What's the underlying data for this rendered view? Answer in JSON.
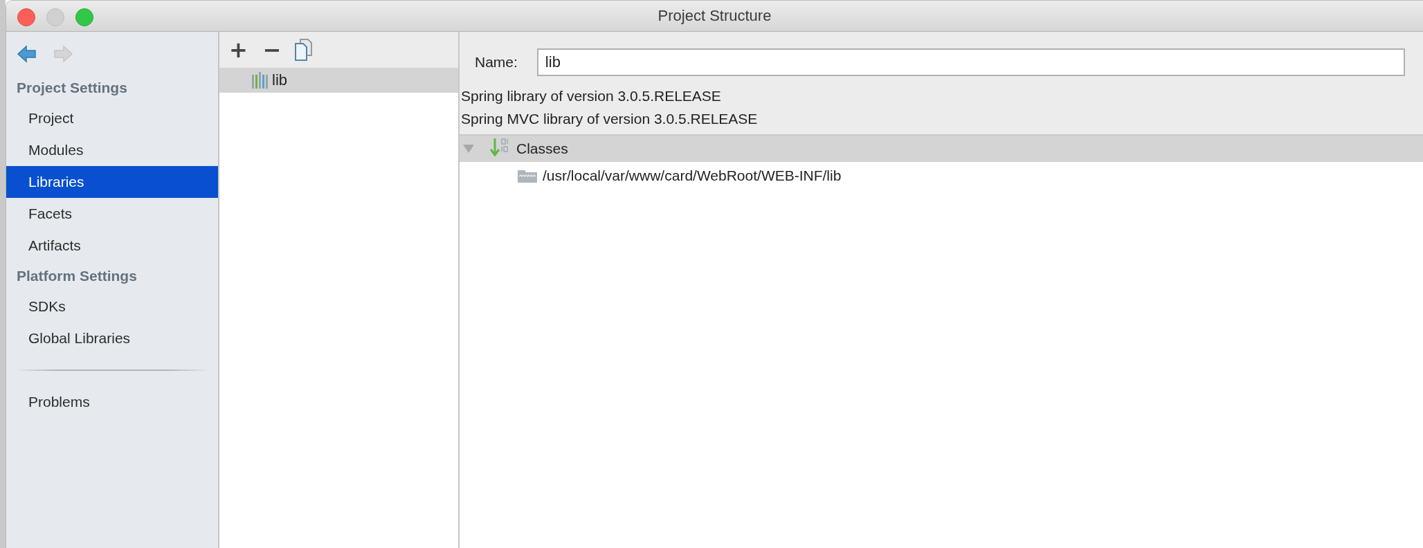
{
  "window": {
    "title": "Project Structure"
  },
  "navigation": {
    "back_disabled": false,
    "forward_disabled": true
  },
  "sidebar": {
    "sections": [
      {
        "heading": "Project Settings",
        "items": [
          {
            "label": "Project",
            "selected": false
          },
          {
            "label": "Modules",
            "selected": false
          },
          {
            "label": "Libraries",
            "selected": true
          },
          {
            "label": "Facets",
            "selected": false
          },
          {
            "label": "Artifacts",
            "selected": false
          }
        ]
      },
      {
        "heading": "Platform Settings",
        "items": [
          {
            "label": "SDKs",
            "selected": false
          },
          {
            "label": "Global Libraries",
            "selected": false
          }
        ]
      },
      {
        "items": [
          {
            "label": "Problems",
            "selected": false
          }
        ]
      }
    ]
  },
  "libraries": {
    "toolbar": [
      "+",
      "−"
    ],
    "items": [
      {
        "label": "lib",
        "selected": true
      }
    ]
  },
  "details": {
    "name_label": "Name:",
    "name_value": "lib",
    "descriptions": [
      "Spring library of version 3.0.5.RELEASE",
      "Spring MVC library of version 3.0.5.RELEASE"
    ],
    "tree": [
      {
        "label": "Classes",
        "kind": "classes",
        "expanded": true,
        "children": [
          {
            "label": "/usr/local/var/www/card/WebRoot/WEB-INF/lib",
            "kind": "folder"
          }
        ]
      }
    ]
  }
}
